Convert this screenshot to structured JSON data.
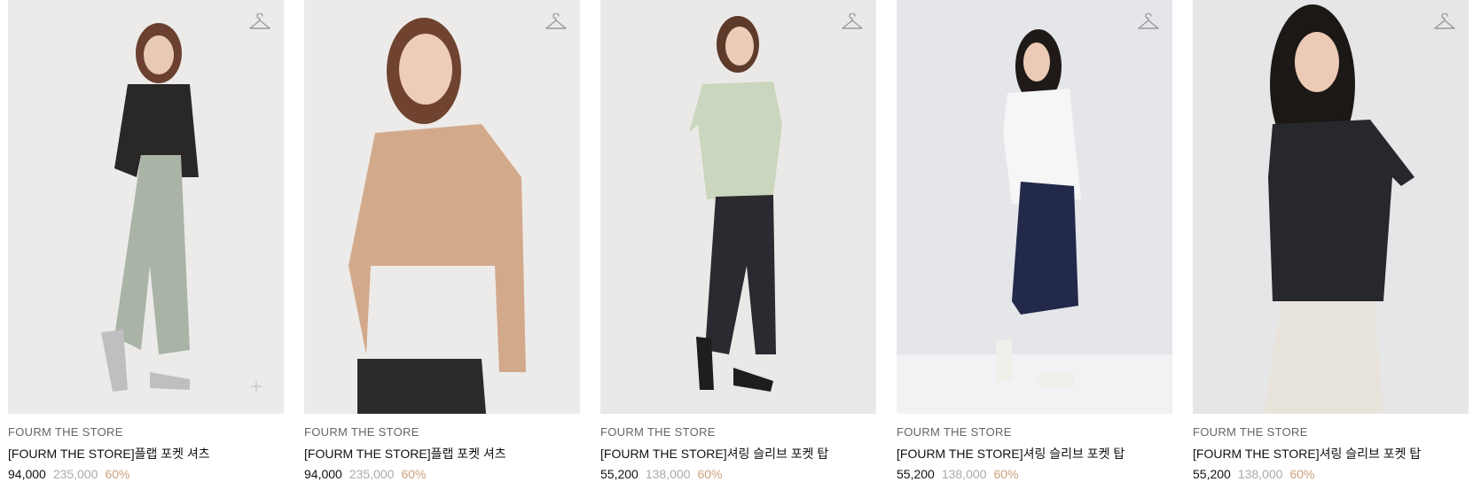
{
  "products": [
    {
      "brand": "FOURM THE STORE",
      "name": "[FOURM THE STORE]플랩 포켓 셔츠",
      "sale_price": "94,000",
      "original_price": "235,000",
      "discount": "60%",
      "colors": {
        "bg": "#ecebe9",
        "top": "#2a2826",
        "bottom": "#a9b3a6",
        "skin": "#e8c9b4",
        "hair": "#6b4030",
        "shoe": "#bfbfbf"
      }
    },
    {
      "brand": "FOURM THE STORE",
      "name": "[FOURM THE STORE]플랩 포켓 셔츠",
      "sale_price": "94,000",
      "original_price": "235,000",
      "discount": "60%",
      "colors": {
        "bg": "#ecebe9",
        "top": "#d3a98c",
        "bottom": "#2a2a2a",
        "skin": "#edcdb9",
        "hair": "#6f4330",
        "shoe": "#2a2a2a"
      }
    },
    {
      "brand": "FOURM THE STORE",
      "name": "[FOURM THE STORE]셔링 슬리브 포켓 탑",
      "sale_price": "55,200",
      "original_price": "138,000",
      "discount": "60%",
      "colors": {
        "bg": "#eae9e7",
        "top": "#cad6bd",
        "bottom": "#2a2a30",
        "skin": "#ecccb6",
        "hair": "#5e3a2a",
        "shoe": "#1e1e1e"
      }
    },
    {
      "brand": "FOURM THE STORE",
      "name": "[FOURM THE STORE]셔링 슬리브 포켓 탑",
      "sale_price": "55,200",
      "original_price": "138,000",
      "discount": "60%",
      "colors": {
        "bg": "#e4e6ea",
        "top": "#f6f6f6",
        "bottom": "#22294a",
        "skin": "#eccab5",
        "hair": "#1f1a18",
        "shoe": "#f0efea"
      }
    },
    {
      "brand": "FOURM THE STORE",
      "name": "[FOURM THE STORE]셔링 슬리브 포켓 탑",
      "sale_price": "55,200",
      "original_price": "138,000",
      "discount": "60%",
      "colors": {
        "bg": "#e6e6e8",
        "top": "#26282c",
        "bottom": "#e8e4dc",
        "skin": "#eccab6",
        "hair": "#1c1816",
        "shoe": "#e8e4dc"
      }
    }
  ],
  "icons": {
    "wishlist": "hanger-icon",
    "zoom": "plus-icon"
  }
}
